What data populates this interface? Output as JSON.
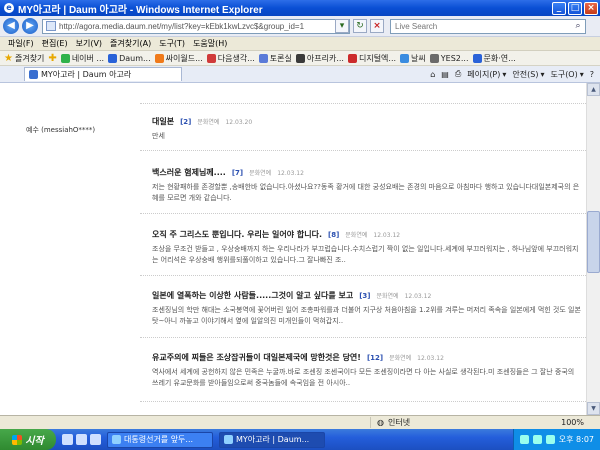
{
  "window": {
    "title": "MY아고라 | Daum 아고라 - Windows Internet Explorer",
    "buttons": {
      "minimize": "_",
      "maximize": "□",
      "close": "×"
    }
  },
  "address": {
    "url": "http://agora.media.daum.net/my/list?key=kEbk1kwLzvc$&group_id=1",
    "search_placeholder": "Live Search"
  },
  "menu": [
    "파일(F)",
    "편집(E)",
    "보기(V)",
    "즐겨찾기(A)",
    "도구(T)",
    "도움말(H)"
  ],
  "favorites": {
    "label": "즐겨찾기",
    "items": [
      {
        "label": "네이버 ...",
        "color": "#2fb24a"
      },
      {
        "label": "Daum...",
        "color": "#2a62d8"
      },
      {
        "label": "싸이월드...",
        "color": "#f07a1a"
      },
      {
        "label": "다음생각...",
        "color": "#d03a3a"
      },
      {
        "label": "토론실",
        "color": "#5a7ad8"
      },
      {
        "label": "아프리카...",
        "color": "#3a3a3a"
      },
      {
        "label": "디지털엑...",
        "color": "#cc2b2b"
      },
      {
        "label": "날씨",
        "color": "#3a8ce0"
      },
      {
        "label": "YES2...",
        "color": "#6a6a6a"
      },
      {
        "label": "문화·연...",
        "color": "#2a62d8"
      }
    ]
  },
  "tab": {
    "label": "MY아고라 | Daum 아고라"
  },
  "commands": [
    "페이지(P)",
    "안전(S)",
    "도구(O)"
  ],
  "user": {
    "name": "예수 (messiahO****)"
  },
  "posts": [
    {
      "title": "대일본",
      "count": "[2]",
      "category": "문화연예",
      "date": "12.03.20",
      "body": "만세"
    },
    {
      "title": "백스러운 혐제님께....",
      "count": "[7]",
      "category": "문화연예",
      "date": "12.03.12",
      "body": "저는 현황패하를 존경할뿐 ,송배한바 없습니다.아셨나요??동족 황거에 대한 궁성요배는 존경의 마음으로 아침마다 행하고 있습니다대일본제국의 은혜를 모르면 개와 같습니다."
    },
    {
      "title": "오직 주 그리스도 뿐입니다. 우리는 일어야 합니다.",
      "count": "[8]",
      "category": "문화연예",
      "date": "12.03.12",
      "body": "조상을 무조건 받들고 , 우상숭배까지 하는 우리나라가 부끄럽습니다.수치스럽기 짝이 없는 일입니다.세계에 부끄러워지는 , 하나님앞에 부끄러워지는 어리석은 우상숭배 행위를되풀이하고 있습니다.그 잘나빠진 조.."
    },
    {
      "title": "일본에 열폭하는 이상한 사람들.....그것이 알고 싶다를 보고",
      "count": "[3]",
      "category": "문화연예",
      "date": "12.03.12",
      "body": "조센징님의 학만 해대는 소국봉역에 꽃어버린 일어 조총파워를과 더불어 지구상 처음아침을 1.2위를 겨루는 머저리 족속을 일본에게 먹힌 것도 일본탓~아니 까놓고 이야기해서 옆에 일알의진 미개인들이 먹혀갑지.."
    },
    {
      "title": "유교주의에 찌들은 조상잡귀들이 대일본제국에 망한것은 당연!",
      "count": "[12]",
      "category": "문화연예",
      "date": "12.03.12",
      "body": "역사에서 세계에 공헌하지 않은 민족은 누굴까.바로 조센징 조센국이다 모든 조센징이라면 다 아는 사실로 생각된다.미 조센징들은 그 잘난 중국의 쓰레기 유교문화를 받아들임으로써 중국놈들에 속국임을 전 아시아.."
    }
  ],
  "status": {
    "zone": "인터넷",
    "zoom": "100%"
  },
  "taskbar": {
    "start": "시작",
    "items": [
      {
        "label": "대통령선거를 앞두...",
        "active": false
      },
      {
        "label": "MY아고라 | Daum...",
        "active": true
      }
    ],
    "clock": "오후 8:07"
  }
}
